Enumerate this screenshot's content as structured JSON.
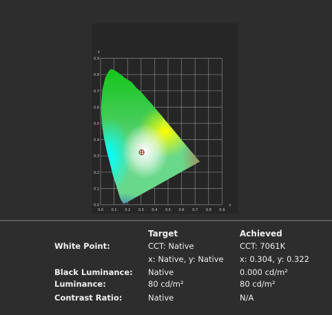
{
  "chart": {
    "x_axis_label": "x",
    "y_axis_label": "y",
    "x_ticks": [
      "0.0",
      "0.1",
      "0.2",
      "0.3",
      "0.4",
      "0.5",
      "0.6",
      "0.7",
      "0.8",
      "0.9"
    ],
    "y_ticks": [
      "0.1",
      "0.2",
      "0.3",
      "0.4",
      "0.5",
      "0.6",
      "0.7",
      "0.8",
      "0.9"
    ],
    "y_origin_tick": "0.0",
    "white_point": {
      "x": 0.304,
      "y": 0.322
    },
    "marker_icon": "crosshair-circle-icon",
    "marker_color": "#c00000"
  },
  "table": {
    "col_target": "Target",
    "col_achieved": "Achieved",
    "rows": [
      {
        "label": "White Point:",
        "target": "CCT: Native",
        "achieved": "CCT: 7061K"
      },
      {
        "label": "",
        "target": "x: Native, y: Native",
        "achieved": "x: 0.304, y: 0.322"
      },
      {
        "label": "Black Luminance:",
        "target": "Native",
        "achieved": "0.000 cd/m²"
      },
      {
        "label": "Luminance:",
        "target": "80 cd/m²",
        "achieved": "80 cd/m²"
      },
      {
        "label": "Contrast Ratio:",
        "target": "Native",
        "achieved": "N/A"
      }
    ]
  }
}
